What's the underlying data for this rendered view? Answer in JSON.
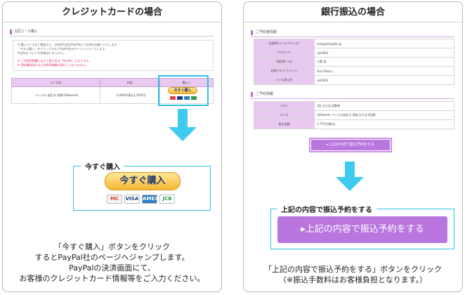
{
  "left": {
    "title": "クレジットカードの場合",
    "section_heading": "1回コース購入",
    "notes": [
      "※ 購入コースをご確認の上、決済代行会社PayPalにて決済をお願いいたします。",
      "「今すぐ購入」をクリックするとPayPal社のページへジャンプします。",
      "PayPalについての詳細はこちらから。"
    ],
    "warnings": [
      "※ ご利用明細書において表示名は「PayPal」となります。",
      "※ 請求書面発行のご利用明細書は発行しておりません。"
    ],
    "table": {
      "headers": [
        "コース名",
        "料金",
        "購入へ"
      ],
      "row": {
        "course": "ペンパル 送信 & 添削(100words)",
        "price": "1,000円(税込1,050円)"
      }
    },
    "mini_buy_label": "今すぐ購入",
    "callout_label": "今すぐ購入",
    "buy_button_label": "今すぐ購入",
    "cards": [
      "MC",
      "VISA",
      "AMEX",
      "JCB"
    ],
    "instructions": [
      "「今すぐ購入」ボタンをクリック",
      "するとPayPal社のページへジャンプします。",
      "PayPalの決済画面にて、",
      "お客様のクレジットカード情報等をご入力ください。"
    ]
  },
  "right": {
    "title": "銀行振込の場合",
    "member_heading": "ご予約者情報",
    "member_rows": [
      {
        "label": "会員ID(メールアドレス)",
        "value": "ono@palingate.jp"
      },
      {
        "label": "パスワード",
        "value": "sat1963"
      },
      {
        "label": "名前(姓・名)",
        "value": "小野 悟"
      },
      {
        "label": "名前(アルファベット)",
        "value": "Ono Satoru"
      },
      {
        "label": "メール表示名",
        "value": "sat1963"
      }
    ],
    "reserve_heading": "ご予約情報",
    "reserve_rows": [
      {
        "label": "プラン",
        "value": "1回 または 回数券"
      },
      {
        "label": "コース",
        "value": "100words ペンパル送信 & 添削 または 6回券"
      },
      {
        "label": "振込金額",
        "value": "5,775円(税込)"
      }
    ],
    "mini_submit_label": "▸上記の内容で振込予約をする",
    "callout_label": "上記の内容で振込予約をする",
    "submit_button_label": "▸上記の内容で振込予約をする",
    "instructions": [
      "「上記の内容で振込予約をする」ボタンをクリック",
      "（※振込手数料はお客様負担となります。）"
    ]
  },
  "colors": {
    "accent_cyan": "#3ecbef",
    "accent_purple": "#b976de",
    "paypal_gold": "#f6b733"
  }
}
